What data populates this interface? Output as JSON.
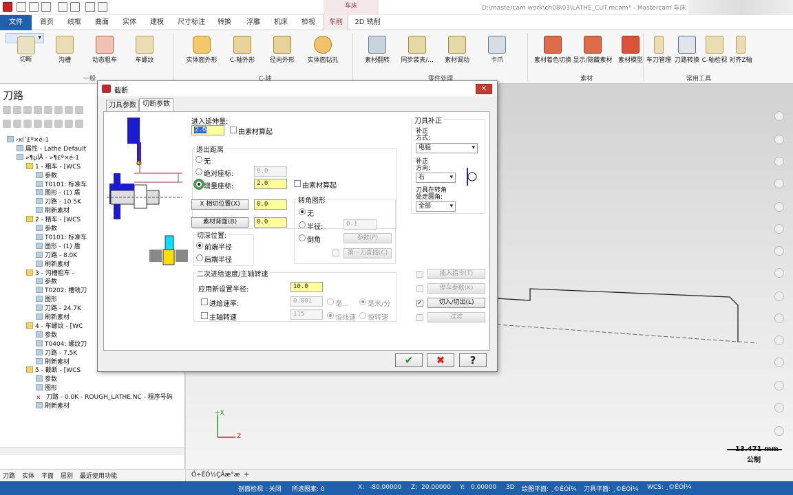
{
  "titlebar": {
    "context_tab": "车床",
    "path": "D:\\mastercam work\\ch08\\03\\LATHE_CUT.mcam* - Mastercam 车床 2019"
  },
  "ribbon_tabs": [
    "文件",
    "首页",
    "线框",
    "曲面",
    "实体",
    "建模",
    "尺寸标注",
    "转换",
    "浮雕",
    "机床",
    "检视",
    "车削",
    "2D 铣削"
  ],
  "ribbon": {
    "general": {
      "label": "一般",
      "buttons": [
        "切断",
        "沟槽",
        "动态粗车",
        "车螺纹"
      ]
    },
    "caxis": {
      "label": "C-轴",
      "buttons": [
        "实体面外形",
        "C-轴外形",
        "径向外形",
        "实体面钻孔"
      ]
    },
    "part": {
      "label": "零件处理",
      "buttons": [
        "素材翻转",
        "同步装夹/...",
        "素材调动",
        "卡爪"
      ]
    },
    "stock": {
      "label": "素材",
      "buttons": [
        "素材着色切换",
        "显示/隐藏素材",
        "素材模型"
      ]
    },
    "tools": {
      "label": "常用工具",
      "buttons": [
        "车刀管理",
        "刀路转换",
        "C-轴检视",
        "对齐Z轴"
      ]
    }
  },
  "left_panel": {
    "title": "刀路",
    "tree": [
      "›xí´£º×é-1",
      "属性 - Lathe Default",
      "»¶µÍÅ - »¶£º×é-1",
      "1 - 粗车 - [WCS",
      "参数",
      "T0101: 标准车",
      "图形 - (1) 盾",
      "刀路 - 10.5K",
      "刷新素材",
      "2 - 精车 - [WCS",
      "参数",
      "T0101: 标准车",
      "图形 - (1) 盾",
      "刀路 - 8.0K",
      "刷新素材",
      "3 - 沟槽粗车 -",
      "参数",
      "T0202: 槽铣刀",
      "图形",
      "刀路 - 24.7K",
      "刷新素材",
      "4 - 车螺纹 - [WC",
      "参数",
      "T0404: 螺纹刀",
      "刀路 - 7.5K",
      "刷新素材",
      "5 - 截断 - [WCS",
      "参数",
      "图形",
      "刀路 - 0.0K - ROUGH_LATHE.NC - 程序号码",
      "刷新素材"
    ],
    "bottom_tabs": [
      "刀路",
      "实体",
      "平面",
      "层别",
      "最近使用功能"
    ]
  },
  "viewport": {
    "scale_value": "13.471 mm",
    "scale_unit": "公制",
    "axis_x": "+X",
    "axis_z": "Z",
    "view_tab": "Ö÷ÊÓ½ÇÃæ°æ"
  },
  "status": {
    "section": "剖面检视 : 关闭",
    "selected": "所选图素: 0",
    "x_label": "X:",
    "x": "-80.00000",
    "z_label": "Z:",
    "z": "20.00000",
    "y_label": "Y:",
    "y": "0.00000",
    "mode": "3D",
    "draw_plane": "绘图平面: ¸©ÊÓÍ¼",
    "tool_plane": "刀具平面: ¸©ÊÓÍ¼",
    "wcs": "WCS: ¸©ÊÓÍ¼"
  },
  "dialog": {
    "title": "截断",
    "tabs": [
      "刀具参数",
      "切断参数"
    ],
    "entry_label": "进入延伸量:",
    "entry_value": "2.0",
    "entry_from_stock": "由素材算起",
    "retract_label": "退出距离",
    "retract_none": "无",
    "retract_abs": "绝对座标:",
    "retract_abs_value": "0.0",
    "retract_inc": "增量座标:",
    "retract_inc_value": "2.0",
    "retract_from_stock": "由素材算起",
    "x_cut_btn": "X 相切位置(X)",
    "x_cut_value": "0.0",
    "back_btn": "素材背面(B)",
    "back_value": "0.0",
    "cut_pos_label": "切深位置:",
    "cut_front": "前端半径",
    "cut_back": "后端半径",
    "corner_label": "转角图形",
    "corner_none": "无",
    "corner_radius": "半径:",
    "corner_radius_value": "0.1",
    "corner_chamfer": "倒角",
    "params_btn": "参数(P)",
    "first_cut_btn": "第一刀直插(C)",
    "secondary_label": "二次进给速度/主轴转速",
    "new_radius_label": "应用新设置半径:",
    "new_radius_value": "10.0",
    "feed_label": "进给速率:",
    "feed_value": "0.001",
    "feed_unit1": "毫...",
    "feed_unit2": "毫米/分",
    "spindle_label": "主轴转速",
    "spindle_value": "115",
    "spindle_opt1": "恒线速",
    "spindle_opt2": "恒转速",
    "comp_label": "刀具补正",
    "comp_mode_label1": "补正",
    "comp_mode_label2": "方式:",
    "comp_mode": "电脑",
    "comp_dir_label1": "补正",
    "comp_dir_label2": "方向:",
    "comp_dir": "右",
    "corner_round_label1": "刀具在转角",
    "corner_round_label2": "处走圆角:",
    "corner_round": "全部",
    "insert_btn": "插入指令(T)",
    "stop_btn": "停车参数(K)",
    "inout_btn": "切入/切出(L)",
    "filter_btn": "过滤",
    "ok": "✔",
    "cancel": "✖",
    "help": "?"
  },
  "colors": {
    "accent": "#1f5fab",
    "lathe_tab": "#a0313b",
    "highlight": "#ffff99",
    "close": "#c8392d"
  }
}
